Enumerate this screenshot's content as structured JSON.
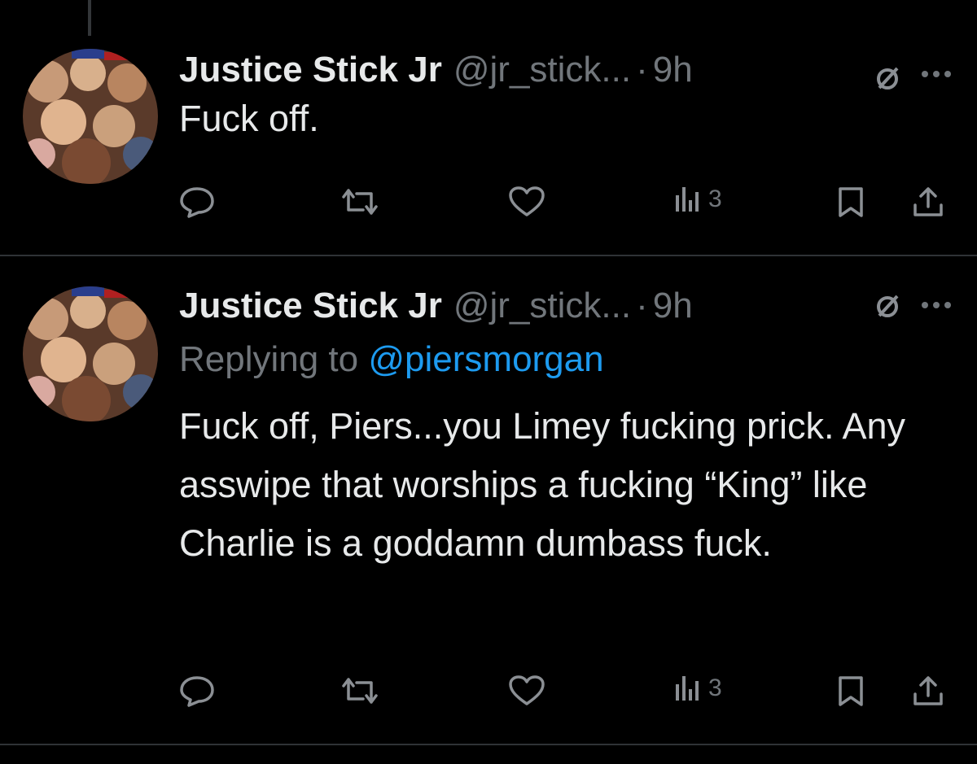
{
  "tweets": [
    {
      "name": "Justice Stick Jr",
      "handle": "@jr_stick...",
      "dot": "·",
      "time": "9h",
      "text": "Fuck off.",
      "views": "3"
    },
    {
      "name": "Justice Stick Jr",
      "handle": "@jr_stick...",
      "dot": "·",
      "time": "9h",
      "replying_prefix": "Replying to",
      "replying_mention": "@piersmorgan",
      "text": "Fuck off, Piers...you Limey fucking prick.  Any asswipe that worships a fucking “King” like Charlie is a goddamn dumbass fuck.",
      "views": "3"
    }
  ],
  "colors": {
    "background": "#000000",
    "text": "#e7e9ea",
    "muted": "#71767b",
    "link": "#1d9bf0"
  },
  "icons": [
    "reply-icon",
    "retweet-icon",
    "like-icon",
    "views-icon",
    "bookmark-icon",
    "share-icon",
    "grok-icon",
    "more-icon"
  ]
}
